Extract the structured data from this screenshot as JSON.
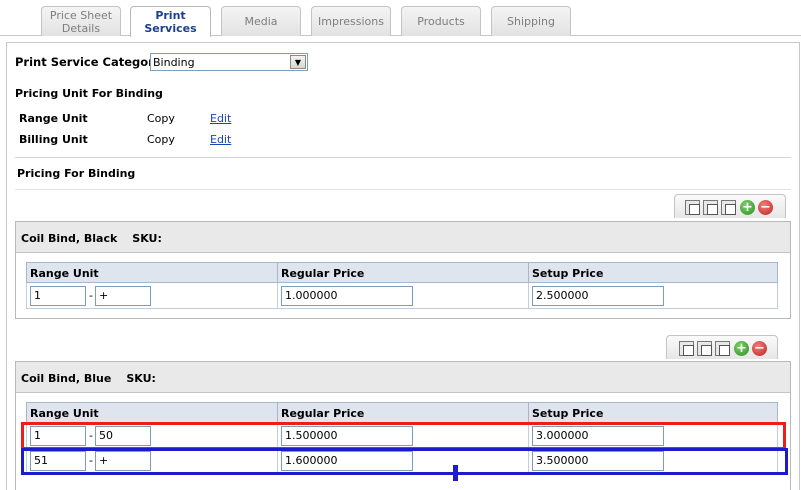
{
  "tabs": [
    {
      "label": "Price Sheet Details",
      "active": false
    },
    {
      "label": "Print Services",
      "active": true
    },
    {
      "label": "Media",
      "active": false
    },
    {
      "label": "Impressions",
      "active": false
    },
    {
      "label": "Products",
      "active": false
    },
    {
      "label": "Shipping",
      "active": false
    }
  ],
  "category": {
    "label": "Print Service Category",
    "selected": "Binding"
  },
  "pricing_unit": {
    "heading": "Pricing Unit For Binding",
    "range": {
      "label": "Range Unit",
      "value": "Copy",
      "edit": "Edit"
    },
    "billing": {
      "label": "Billing Unit",
      "value": "Copy",
      "edit": "Edit"
    }
  },
  "pricing_heading": "Pricing For Binding",
  "columns": {
    "range": "Range Unit",
    "regular": "Regular Price",
    "setup": "Setup Price"
  },
  "sections": [
    {
      "name": "Coil Bind, Black",
      "sku_label": "SKU:",
      "rows": [
        {
          "from": "1",
          "to": "+",
          "regular": "1.000000",
          "setup": "2.500000"
        }
      ]
    },
    {
      "name": "Coil Bind, Blue",
      "sku_label": "SKU:",
      "rows": [
        {
          "from": "1",
          "to": "50",
          "regular": "1.500000",
          "setup": "3.000000"
        },
        {
          "from": "51",
          "to": "+",
          "regular": "1.600000",
          "setup": "3.500000"
        }
      ]
    }
  ],
  "toolbar_icons": [
    "copy-icon",
    "copy-all-icon",
    "paste-icon",
    "add-icon",
    "remove-icon"
  ],
  "colors": {
    "highlight_red": "#ee1c1c",
    "highlight_blue": "#1c1ccc",
    "link": "#1a45b8",
    "active_tab": "#1d3f8f"
  }
}
